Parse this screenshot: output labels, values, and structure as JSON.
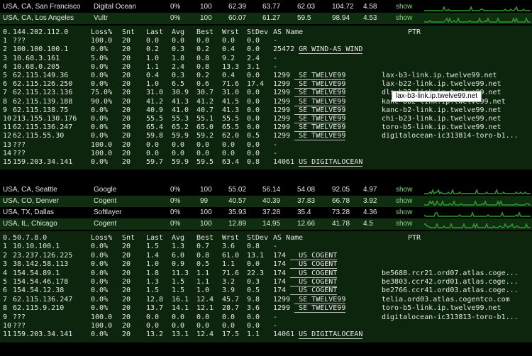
{
  "colors": {
    "page_bg": "#000000",
    "traceroute_bg": "#0d250d",
    "highlight_bg": "#0f2d0f",
    "link": "#7ddc7d",
    "spark": "#2f9b2f"
  },
  "show_label": "show",
  "top_servers": [
    {
      "location": "USA, CA, San Francisco",
      "provider": "Digital Ocean",
      "loss": "0%",
      "sent": "100",
      "last": "62.39",
      "avg": "63.77",
      "best": "62.03",
      "worst": "104.72",
      "stdev": "4.58"
    },
    {
      "location": "USA, CA, Los Angeles",
      "provider": "Vultr",
      "loss": "0%",
      "sent": "100",
      "last": "60.07",
      "avg": "61.27",
      "best": "59.5",
      "worst": "98.94",
      "stdev": "4.53"
    }
  ],
  "trace1": {
    "header": {
      "hop": "0.",
      "host": "144.202.112.0",
      "loss": "Loss%",
      "snt": "Snt",
      "last": "Last",
      "avg": "Avg",
      "best": "Best",
      "wrst": "Wrst",
      "stdev": "StDev",
      "as": "AS Name",
      "ptr": "PTR"
    },
    "rows": [
      {
        "hop": "1",
        "host": "???",
        "loss": "100.0",
        "snt": "20",
        "last": "0.0",
        "avg": "0.0",
        "best": "0.0",
        "wrst": "0.0",
        "stdev": "0.0",
        "as": "-",
        "ptr": ""
      },
      {
        "hop": "2",
        "host": "100.100.100.1",
        "loss": "0.0%",
        "snt": "20",
        "last": "0.2",
        "avg": "0.3",
        "best": "0.2",
        "wrst": "0.4",
        "stdev": "0.0",
        "as": "25472 GR WIND-AS WIND",
        "ptr": ""
      },
      {
        "hop": "3",
        "host": "10.68.3.161",
        "loss": "5.0%",
        "snt": "20",
        "last": "1.0",
        "avg": "1.8",
        "best": "0.8",
        "wrst": "9.2",
        "stdev": "2.4",
        "as": "-",
        "ptr": ""
      },
      {
        "hop": "4",
        "host": "10.68.0.205",
        "loss": "0.0%",
        "snt": "20",
        "last": "1.1",
        "avg": "2.4",
        "best": "0.8",
        "wrst": "13.3",
        "stdev": "3.1",
        "as": "-",
        "ptr": ""
      },
      {
        "hop": "5",
        "host": "62.115.149.36",
        "loss": "0.0%",
        "snt": "20",
        "last": "0.4",
        "avg": "0.3",
        "best": "0.2",
        "wrst": "0.4",
        "stdev": "0.0",
        "as": "1299  SE TWELVE99",
        "ptr": "lax-b3-link.ip.twelve99.net"
      },
      {
        "hop": "6",
        "host": "62.115.126.250",
        "loss": "0.0%",
        "snt": "20",
        "last": "1.0",
        "avg": "6.5",
        "best": "0.6",
        "wrst": "71.6",
        "stdev": "17.4",
        "as": "1299  SE TWELVE99",
        "ptr": "lax-b22-link.ip.twelve99.net"
      },
      {
        "hop": "7",
        "host": "62.115.123.136",
        "loss": "75.0%",
        "snt": "20",
        "last": "31.0",
        "avg": "30.9",
        "best": "30.7",
        "wrst": "31.0",
        "stdev": "0.0",
        "as": "1299  SE TWELVE99",
        "ptr": "dls-b22-link.ip.twelve99.net"
      },
      {
        "hop": "8",
        "host": "62.115.139.188",
        "loss": "90.0%",
        "snt": "20",
        "last": "41.2",
        "avg": "41.3",
        "best": "41.2",
        "wrst": "41.5",
        "stdev": "0.0",
        "as": "1299  SE TWELVE99",
        "ptr": "kanc-bb2-link.ip.twelve99.net"
      },
      {
        "hop": "9",
        "host": "62.115.138.75",
        "loss": "0.0%",
        "snt": "20",
        "last": "40.9",
        "avg": "41.0",
        "best": "40.7",
        "wrst": "41.3",
        "stdev": "0.0",
        "as": "1299  SE TWELVE99",
        "ptr": "kanc-b2-link.ip.twelve99.net"
      },
      {
        "hop": "10",
        "host": "213.155.130.176",
        "loss": "0.0%",
        "snt": "20",
        "last": "55.5",
        "avg": "55.3",
        "best": "55.1",
        "wrst": "55.5",
        "stdev": "0.0",
        "as": "1299  SE TWELVE99",
        "ptr": "chi-b23-link.ip.twelve99.net"
      },
      {
        "hop": "11",
        "host": "62.115.136.247",
        "loss": "0.0%",
        "snt": "20",
        "last": "65.4",
        "avg": "65.2",
        "best": "65.0",
        "wrst": "65.5",
        "stdev": "0.0",
        "as": "1299  SE TWELVE99",
        "ptr": "toro-b5-link.ip.twelve99.net"
      },
      {
        "hop": "12",
        "host": "62.115.55.30",
        "loss": "0.0%",
        "snt": "20",
        "last": "59.8",
        "avg": "59.9",
        "best": "59.2",
        "wrst": "62.0",
        "stdev": "0.5",
        "as": "1299  SE TWELVE99",
        "ptr": "digitalocean-ic313814-toro-b1..."
      },
      {
        "hop": "13",
        "host": "???",
        "loss": "100.0",
        "snt": "20",
        "last": "0.0",
        "avg": "0.0",
        "best": "0.0",
        "wrst": "0.0",
        "stdev": "0.0",
        "as": "-",
        "ptr": ""
      },
      {
        "hop": "14",
        "host": "???",
        "loss": "100.0",
        "snt": "20",
        "last": "0.0",
        "avg": "0.0",
        "best": "0.0",
        "wrst": "0.0",
        "stdev": "0.0",
        "as": "-",
        "ptr": ""
      },
      {
        "hop": "15",
        "host": "159.203.34.141",
        "loss": "0.0%",
        "snt": "20",
        "last": "59.7",
        "avg": "59.9",
        "best": "59.5",
        "wrst": "63.4",
        "stdev": "0.8",
        "as": "14061 US DIGITALOCEAN",
        "ptr": ""
      }
    ],
    "tooltip": "lax-b3-link.ip.twelve99.net"
  },
  "mid_servers": [
    {
      "location": "USA, CA, Seattle",
      "provider": "Google",
      "loss": "0%",
      "sent": "100",
      "last": "55.02",
      "avg": "56.14",
      "best": "54.08",
      "worst": "92.05",
      "stdev": "4.97"
    },
    {
      "location": "USA, CO, Denver",
      "provider": "Cogent",
      "loss": "0%",
      "sent": "99",
      "last": "40.57",
      "avg": "40.39",
      "best": "37.83",
      "worst": "66.78",
      "stdev": "3.92"
    },
    {
      "location": "USA, TX, Dallas",
      "provider": "Softlayer",
      "loss": "0%",
      "sent": "100",
      "last": "35.93",
      "avg": "37.28",
      "best": "35.4",
      "worst": "73.28",
      "stdev": "4.36"
    },
    {
      "location": "USA, IL, Chicago",
      "provider": "Cogent",
      "loss": "0%",
      "sent": "100",
      "last": "12.89",
      "avg": "14.95",
      "best": "12.66",
      "worst": "41.78",
      "stdev": "4.5"
    }
  ],
  "trace2": {
    "header": {
      "hop": "0.",
      "host": "50.7.8.0",
      "loss": "Loss%",
      "snt": "Snt",
      "last": "Last",
      "avg": "Avg",
      "best": "Best",
      "wrst": "Wrst",
      "stdev": "StDev",
      "as": "AS Name",
      "ptr": "PTR"
    },
    "rows": [
      {
        "hop": "1",
        "host": "10.10.100.1",
        "loss": "0.0%",
        "snt": "20",
        "last": "1.5",
        "avg": "1.3",
        "best": "0.7",
        "wrst": "3.6",
        "stdev": "0.8",
        "as": "-",
        "ptr": ""
      },
      {
        "hop": "2",
        "host": "23.237.126.225",
        "loss": "0.0%",
        "snt": "20",
        "last": "1.4",
        "avg": "6.0",
        "best": "0.8",
        "wrst": "61.0",
        "stdev": "13.1",
        "as": "174   US COGENT",
        "ptr": ""
      },
      {
        "hop": "3",
        "host": "38.142.58.113",
        "loss": "0.0%",
        "snt": "20",
        "last": "1.0",
        "avg": "0.9",
        "best": "0.5",
        "wrst": "1.1",
        "stdev": "0.0",
        "as": "174   US COGENT",
        "ptr": ""
      },
      {
        "hop": "4",
        "host": "154.54.89.1",
        "loss": "0.0%",
        "snt": "20",
        "last": "1.8",
        "avg": "11.3",
        "best": "1.1",
        "wrst": "71.6",
        "stdev": "22.3",
        "as": "174   US COGENT",
        "ptr": "be5688.rcr21.ord07.atlas.coge..."
      },
      {
        "hop": "5",
        "host": "154.54.46.178",
        "loss": "0.0%",
        "snt": "20",
        "last": "1.3",
        "avg": "1.5",
        "best": "1.1",
        "wrst": "3.2",
        "stdev": "0.3",
        "as": "174   US COGENT",
        "ptr": "be3803.ccr42.ord01.atlas.coge..."
      },
      {
        "hop": "6",
        "host": "154.54.12.38",
        "loss": "0.0%",
        "snt": "20",
        "last": "1.5",
        "avg": "1.5",
        "best": "1.0",
        "wrst": "3.9",
        "stdev": "0.5",
        "as": "174   US COGENT",
        "ptr": "be2766.ccr41.ord03.atlas.coge..."
      },
      {
        "hop": "7",
        "host": "62.115.136.247",
        "loss": "0.0%",
        "snt": "20",
        "last": "12.8",
        "avg": "16.1",
        "best": "12.4",
        "wrst": "45.7",
        "stdev": "9.8",
        "as": "1299  SE TWELVE99",
        "ptr": "telia.ord03.atlas.cogentco.com"
      },
      {
        "hop": "8",
        "host": "62.115.9.210",
        "loss": "0.0%",
        "snt": "20",
        "last": "13.7",
        "avg": "14.1",
        "best": "12.1",
        "wrst": "28.7",
        "stdev": "3.6",
        "as": "1299  SE TWELVE99",
        "ptr": "toro-b5-link.ip.twelve99.net"
      },
      {
        "hop": "9",
        "host": "???",
        "loss": "100.0",
        "snt": "20",
        "last": "0.0",
        "avg": "0.0",
        "best": "0.0",
        "wrst": "0.0",
        "stdev": "0.0",
        "as": "-",
        "ptr": "digitalocean-ic313813-toro-b1..."
      },
      {
        "hop": "10",
        "host": "???",
        "loss": "100.0",
        "snt": "20",
        "last": "0.0",
        "avg": "0.0",
        "best": "0.0",
        "wrst": "0.0",
        "stdev": "0.0",
        "as": "-",
        "ptr": ""
      },
      {
        "hop": "11",
        "host": "159.203.34.141",
        "loss": "0.0%",
        "snt": "20",
        "last": "13.2",
        "avg": "13.1",
        "best": "12.4",
        "wrst": "17.5",
        "stdev": "1.1",
        "as": "14061 US DIGITALOCEAN",
        "ptr": ""
      }
    ]
  }
}
